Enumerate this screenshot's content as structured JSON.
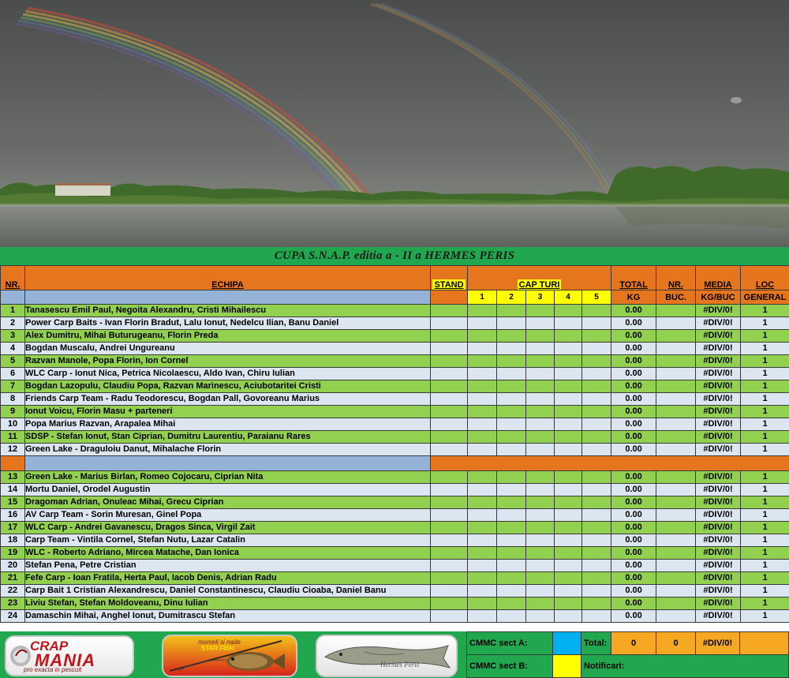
{
  "title": "CUPA S.N.A.P. editia a - II a  HERMES  PERIS",
  "headers": {
    "nr": "NR.",
    "echipa": "ECHIPA",
    "stand": "STAND",
    "capturi": "CAP  TURI",
    "total": "TOTAL",
    "nr_buc": "NR.",
    "media": "MEDIA",
    "loc": "LOC",
    "rounds": [
      "1",
      "2",
      "3",
      "4",
      "5"
    ],
    "kg": "KG",
    "buc": "BUC.",
    "kg_buc": "KG/BUC",
    "general": "GENERAL"
  },
  "sector_a": [
    {
      "nr": "1",
      "team": "Tanasescu Emil Paul, Negoita Alexandru, Cristi Mihailescu",
      "total": "0.00",
      "media": "#DIV/0!",
      "loc": "1"
    },
    {
      "nr": "2",
      "team": "Power Carp Baits - Ivan Florin Bradut, Lalu Ionut, Nedelcu Ilian, Banu Daniel",
      "total": "0.00",
      "media": "#DIV/0!",
      "loc": "1"
    },
    {
      "nr": "3",
      "team": "Alex Dumitru, Mihai Buturugeanu, Florin Preda",
      "total": "0.00",
      "media": "#DIV/0!",
      "loc": "1"
    },
    {
      "nr": "4",
      "team": "Bogdan Muscalu, Andrei Ungureanu",
      "total": "0.00",
      "media": "#DIV/0!",
      "loc": "1"
    },
    {
      "nr": "5",
      "team": "Razvan Manole, Popa Florin, Ion Cornel",
      "total": "0.00",
      "media": "#DIV/0!",
      "loc": "1"
    },
    {
      "nr": "6",
      "team": "WLC Carp - Ionut Nica, Petrica Nicolaescu, Aldo Ivan, Chiru Iulian",
      "total": "0.00",
      "media": "#DIV/0!",
      "loc": "1"
    },
    {
      "nr": "7",
      "team": "Bogdan Lazopulu, Claudiu Popa, Razvan Marinescu, Aciubotaritei Cristi",
      "total": "0.00",
      "media": "#DIV/0!",
      "loc": "1"
    },
    {
      "nr": "8",
      "team": " Friends Carp Team - Radu Teodorescu, Bogdan Pall, Govoreanu Marius",
      "total": "0.00",
      "media": "#DIV/0!",
      "loc": "1"
    },
    {
      "nr": "9",
      "team": "Ionut Voicu, Florin Masu + parteneri",
      "total": "0.00",
      "media": "#DIV/0!",
      "loc": "1"
    },
    {
      "nr": "10",
      "team": "Popa Marius Razvan, Arapalea Mihai",
      "total": "0.00",
      "media": "#DIV/0!",
      "loc": "1"
    },
    {
      "nr": "11",
      "team": "SDSP - Stefan Ionut, Stan Ciprian, Dumitru Laurentiu, Paraianu Rares",
      "total": "0.00",
      "media": "#DIV/0!",
      "loc": "1"
    },
    {
      "nr": "12",
      "team": "Green Lake - Draguloiu Danut, Mihalache Florin",
      "total": "0.00",
      "media": "#DIV/0!",
      "loc": "1"
    }
  ],
  "sector_b": [
    {
      "nr": "13",
      "team": "Green Lake - Marius Birlan, Romeo Cojocaru, Ciprian Nita",
      "total": "0.00",
      "media": "#DIV/0!",
      "loc": "1"
    },
    {
      "nr": "14",
      "team": "Mortu Daniel, Orodel Augustin",
      "total": "0.00",
      "media": "#DIV/0!",
      "loc": "1"
    },
    {
      "nr": "15",
      "team": "Dragoman Adrian, Onuleac Mihai, Grecu Ciprian",
      "total": "0.00",
      "media": "#DIV/0!",
      "loc": "1"
    },
    {
      "nr": "16",
      "team": "AV Carp Team - Sorin Muresan, Ginel Popa",
      "total": "0.00",
      "media": "#DIV/0!",
      "loc": "1"
    },
    {
      "nr": "17",
      "team": "WLC Carp - Andrei Gavanescu, Dragos Sinca, Virgil Zait",
      "total": "0.00",
      "media": "#DIV/0!",
      "loc": "1"
    },
    {
      "nr": "18",
      "team": "Carp Team - Vintila Cornel, Stefan Nutu, Lazar Catalin",
      "total": "0.00",
      "media": "#DIV/0!",
      "loc": "1"
    },
    {
      "nr": "19",
      "team": "WLC - Roberto Adriano, Mircea Matache, Dan Ionica",
      "total": "0.00",
      "media": "#DIV/0!",
      "loc": "1"
    },
    {
      "nr": "20",
      "team": "Stefan Pena, Petre Cristian",
      "total": "0.00",
      "media": "#DIV/0!",
      "loc": "1"
    },
    {
      "nr": "21",
      "team": "Fefe Carp - Ioan Fratila, Herta Paul, Iacob Denis, Adrian Radu",
      "total": "0.00",
      "media": "#DIV/0!",
      "loc": "1"
    },
    {
      "nr": "22",
      "team": "Carp Bait 1 Cristian Alexandrescu, Daniel Constantinescu, Claudiu Cioaba, Daniel Banu",
      "total": "0.00",
      "media": "#DIV/0!",
      "loc": "1"
    },
    {
      "nr": "23",
      "team": "Liviu Stefan, Stefan Moldoveanu, Dinu Iulian",
      "total": "0.00",
      "media": "#DIV/0!",
      "loc": "1"
    },
    {
      "nr": "24",
      "team": "Damaschin Mihai, Anghel Ionut, Dumitrascu Stefan",
      "total": "0.00",
      "media": "#DIV/0!",
      "loc": "1"
    }
  ],
  "footer": {
    "cmmc_a": "CMMC sect A:",
    "cmmc_b": "CMMC sect B:",
    "total_label": "Total:",
    "total_kg": "0",
    "total_buc": "0",
    "total_media": "#DIV/0!",
    "notificari": "Notificari:"
  },
  "logos": {
    "crap_top": "CRAP",
    "crap_main": "MANIA",
    "crap_tagline": "pro exacta in pescuit",
    "star_top": "momeli si nade",
    "star_main": "STAR FISH",
    "hermes": "Hermes Peris"
  },
  "colors": {
    "green_row": "#92d050",
    "white_row": "#dce6f1",
    "header_orange": "#e6761d",
    "title_green": "#21a84f",
    "accent_yellow": "#ffff00",
    "accent_blue": "#00b0f0"
  }
}
